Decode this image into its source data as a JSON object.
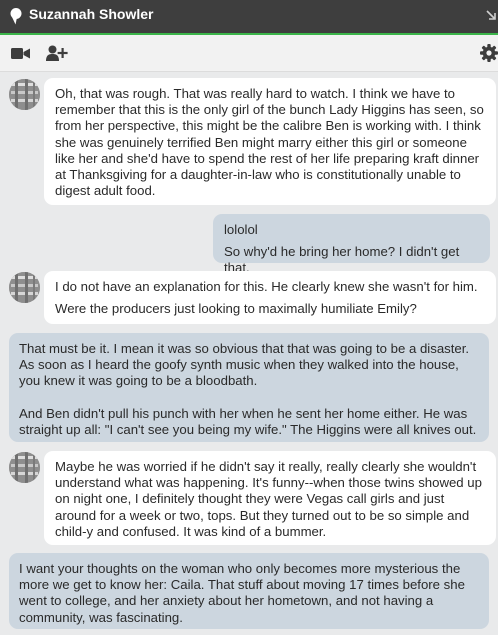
{
  "window": {
    "title": "Suzannah Showler"
  },
  "toolbar": {
    "icons": [
      "video-camera-icon",
      "add-contact-icon",
      "gear-icon"
    ]
  },
  "messages": [
    {
      "type": "incoming",
      "paragraphs": [
        "Oh, that was rough. That was really hard to watch. I think we have to remember that this is the only girl of the bunch Lady Higgins has seen, so from her perspective, this might be the calibre Ben is working with. I think she was genuinely terrified Ben might marry either this girl or someone like her and she'd have to spend the rest of her life preparing kraft dinner at Thanksgiving for a daughter-in-law who is constitutionally unable to digest adult food."
      ]
    },
    {
      "type": "outgoing",
      "paragraphs": [
        "lololol",
        "So why'd he bring her home? I didn't get that."
      ]
    },
    {
      "type": "incoming",
      "paragraphs": [
        "I do not have an explanation for this. He clearly knew she wasn't for him.",
        "Were the producers just looking to maximally humiliate Emily?"
      ]
    },
    {
      "type": "outgoing",
      "paragraphs": [
        "That must be it. I mean it was so obvious that that was going to be a disaster. As soon as I heard the goofy synth music when they walked into the house, you knew it was going to be a bloodbath.",
        "And Ben didn't pull his punch with her when he sent her home either. He was straight up all: \"I can't see you being my wife.\" The Higgins were all knives out."
      ]
    },
    {
      "type": "incoming",
      "paragraphs": [
        "Maybe he was worried if he didn't say it really, really clearly she wouldn't understand what was happening. It's funny--when those twins showed up on night one, I definitely thought they were Vegas call girls and just around for a week or two, tops. But they turned out to be so simple and child-y and confused. It was kind of a bummer."
      ]
    },
    {
      "type": "outgoing",
      "paragraphs": [
        "I want your thoughts on the woman who only becomes more mysterious the more we get to know her: Caila. That stuff about moving 17 times before she went to college, and her anxiety about her hometown, and not having a community, was fascinating."
      ]
    }
  ]
}
